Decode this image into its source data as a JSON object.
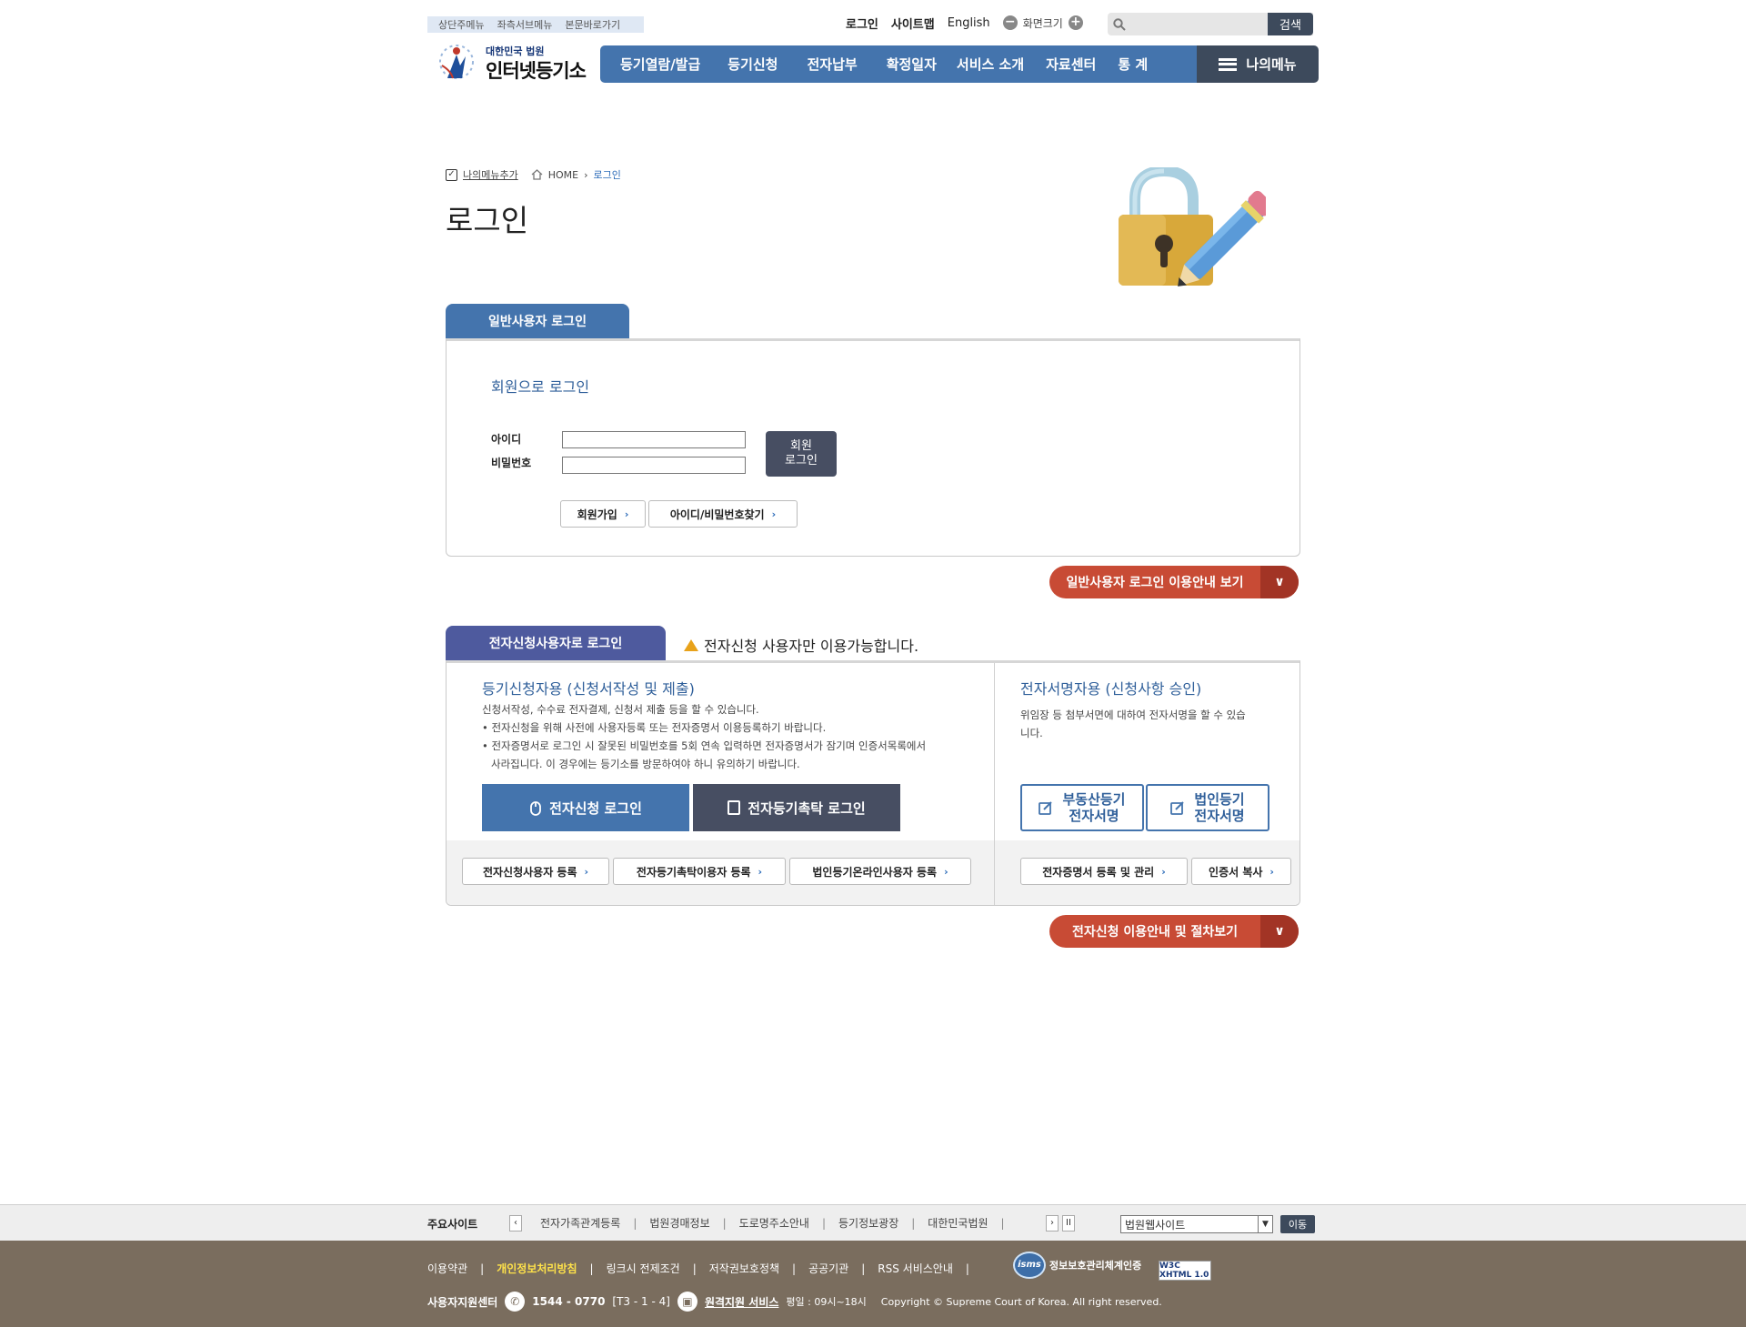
{
  "skip_links": [
    "상단주메뉴",
    "좌측서브메뉴",
    "본문바로가기"
  ],
  "util": {
    "login": "로그인",
    "sitemap": "사이트맵",
    "english": "English",
    "zoom_label": "화면크기",
    "search_button": "검색"
  },
  "logo": {
    "top": "대한민국 법원",
    "main": "인터넷등기소"
  },
  "gnb": [
    "등기열람/발급",
    "등기신청",
    "전자납부",
    "확정일자",
    "서비스 소개",
    "자료센터",
    "통 계"
  ],
  "mymenu": "나의메뉴",
  "breadcrumb": {
    "add": "나의메뉴추가",
    "home": "HOME",
    "current": "로그인"
  },
  "page_title": "로그인",
  "general_login": {
    "tab": "일반사용자 로그인",
    "member_title": "회원으로 로그인",
    "id_label": "아이디",
    "pw_label": "비밀번호",
    "login_button_line1": "회원",
    "login_button_line2": "로그인",
    "join": "회원가입",
    "find": "아이디/비밀번호찾기",
    "guide": "일반사용자 로그인 이용안내 보기"
  },
  "eapp_login": {
    "tab": "전자신청사용자로 로그인",
    "warning": "전자신청 사용자만 이용가능합니다.",
    "left_title": "등기신청자용 (신청서작성 및 제출)",
    "left_desc": [
      "신청서작성, 수수료 전자결제, 신청서 제출 등을 할 수 있습니다.",
      "• 전자신청을 위해 사전에 사용자등록 또는 전자증명서 이용등록하기 바랍니다.",
      "• 전자증명서로 로그인 시 잘못된 비밀번호를 5회 연속 입력하면 전자증명서가 잠기며 인증서목록에서",
      "사라집니다. 이 경우에는 등기소를 방문하여야 하니 유의하기 바랍니다."
    ],
    "eapp_login_button": "전자신청 로그인",
    "trust_login_button": "전자등기촉탁 로그인",
    "reg_buttons": [
      "전자신청사용자 등록",
      "전자등기촉탁이용자 등록",
      "법인등기온라인사용자 등록"
    ],
    "right_title": "전자서명자용 (신청사항 승인)",
    "right_desc": [
      "위임장 등 첨부서면에 대하여 전자서명을 할 수 있습",
      "니다."
    ],
    "sign_real_line1": "부동산등기",
    "sign_real_line2": "전자서명",
    "sign_corp_line1": "법인등기",
    "sign_corp_line2": "전자서명",
    "cert_mgmt": "전자증명서 등록 및 관리",
    "cert_copy": "인증서 복사",
    "guide": "전자신청 이용안내 및 절차보기"
  },
  "footer": {
    "sites_label": "주요사이트",
    "sites": [
      "전자가족관계등록",
      "법원경매정보",
      "도로명주소안내",
      "등기정보광장",
      "대한민국법원"
    ],
    "select_value": "법원웹사이트",
    "go_button": "이동",
    "links": [
      "이용약관",
      "개인정보처리방침",
      "링크시 전제조건",
      "저작권보호정책",
      "공공기관",
      "RSS 서비스안내"
    ],
    "isms_label": "정보보호관리체계인증",
    "isms_logo": "isms",
    "w3c": "W3C XHTML 1.0",
    "center": "사용자지원센터",
    "phone": "1544 - 0770",
    "phone_ext": "[T3 - 1 - 4]",
    "remote": "원격지원 서비스",
    "hours": "평일 : 09시~18시",
    "copyright": "Copyright © Supreme Court of Korea. All right reserved."
  },
  "colors": {
    "primary_blue": "#4474ad",
    "dark_navy": "#3d4a5c",
    "purple_tab": "#4e5a9e",
    "guide_red": "#c84b35",
    "footer_brown": "#7a6d5e"
  }
}
